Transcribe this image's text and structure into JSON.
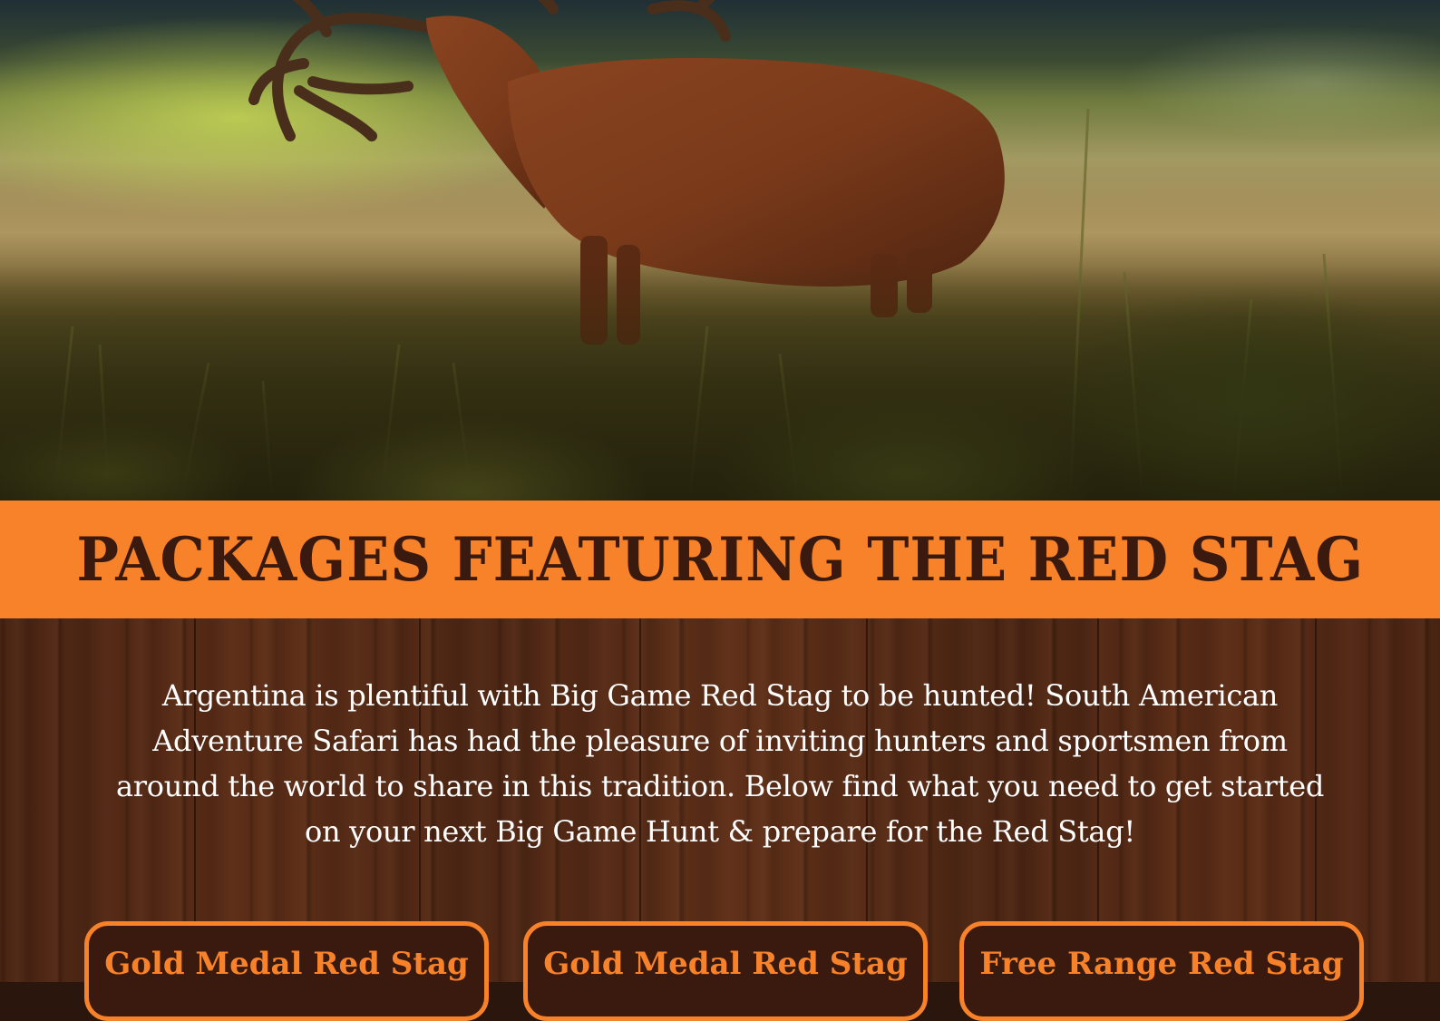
{
  "hero": {
    "alt": "Red stag standing in tall grass"
  },
  "banner": {
    "title": "PACKAGES FEATURING THE RED STAG"
  },
  "intro": {
    "text": "Argentina is plentiful with Big Game Red Stag to be hunted! South American Adventure Safari has had the pleasure of inviting hunters and sportsmen from around the world to share in this tradition. Below find what you need to get started on your next Big Game Hunt & prepare for the Red Stag!"
  },
  "packages": [
    {
      "label": "Gold Medal Red Stag"
    },
    {
      "label": "Gold Medal Red Stag"
    },
    {
      "label": "Free Range Red Stag"
    }
  ],
  "colors": {
    "accent": "#f8822a",
    "dark_brown": "#3a1a0e",
    "text_light": "#ffffff"
  }
}
